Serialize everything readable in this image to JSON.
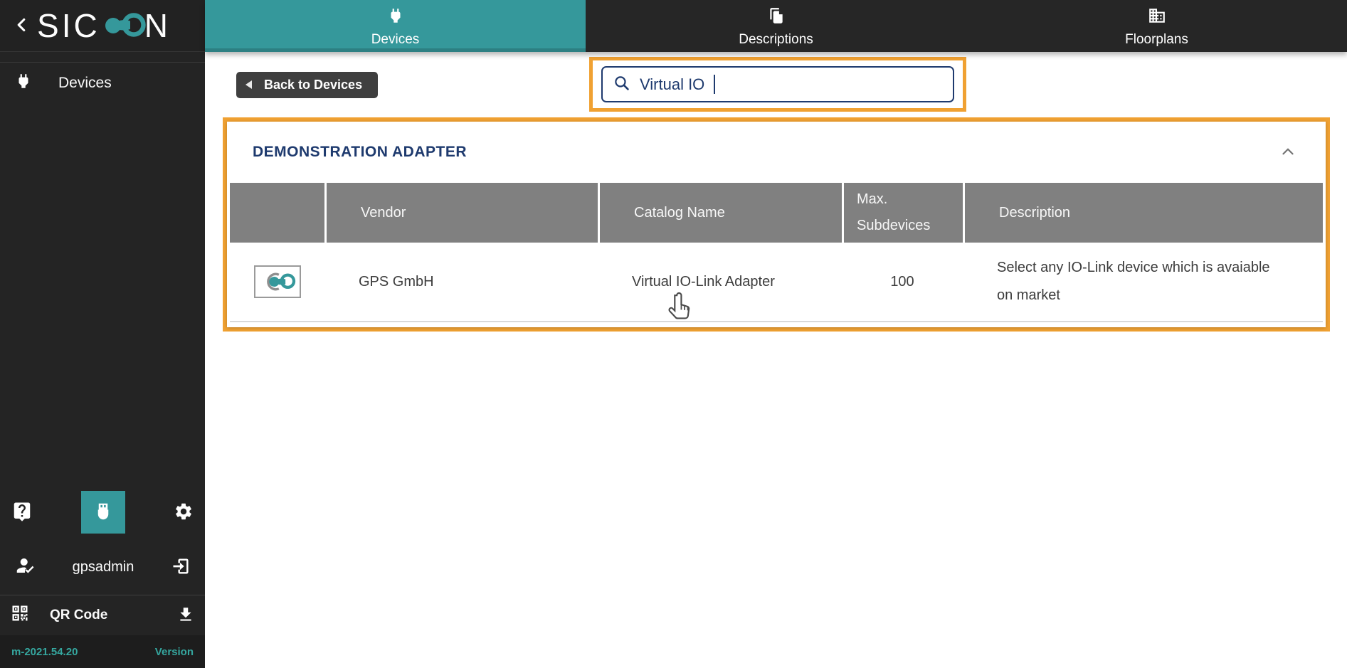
{
  "logo": {
    "left": "SIC",
    "right": "N"
  },
  "sidebar": {
    "devices_label": "Devices",
    "user_name": "gpsadmin",
    "qr_label": "QR Code",
    "version_value": "m-2021.54.20",
    "version_label": "Version"
  },
  "tabs": [
    {
      "label": "Devices",
      "icon": "plug-icon",
      "active": true
    },
    {
      "label": "Descriptions",
      "icon": "documents-icon",
      "active": false
    },
    {
      "label": "Floorplans",
      "icon": "building-icon",
      "active": false
    }
  ],
  "toolbar": {
    "back_label": "Back to Devices"
  },
  "search": {
    "value": "Virtual IO"
  },
  "panel": {
    "title": "DEMONSTRATION ADAPTER",
    "table": {
      "headers": [
        "",
        "Vendor",
        "Catalog Name",
        "Max. Subdevices",
        "Description"
      ],
      "rows": [
        {
          "vendor": "GPS GmbH",
          "catalog": "Virtual IO-Link Adapter",
          "max_subdevices": "100",
          "description": "Select any IO-Link device which is avaiable on market"
        }
      ]
    }
  },
  "icons": [
    "chevron-left-icon",
    "plug-icon",
    "documents-icon",
    "building-icon",
    "help-icon",
    "usb-device-icon",
    "gear-icon",
    "user-check-icon",
    "logout-icon",
    "qr-code-icon",
    "download-icon",
    "search-icon",
    "chevron-up-icon",
    "back-arrow-icon",
    "hand-pointer-icon",
    "adapter-logo-icon"
  ],
  "colors": {
    "teal_accent": "#35989b",
    "annotation_orange": "#f0a132",
    "navy_text": "#1e3a6e",
    "table_header_gray": "#808080",
    "sidebar_dark": "#242424",
    "version_teal": "#35a79f"
  }
}
